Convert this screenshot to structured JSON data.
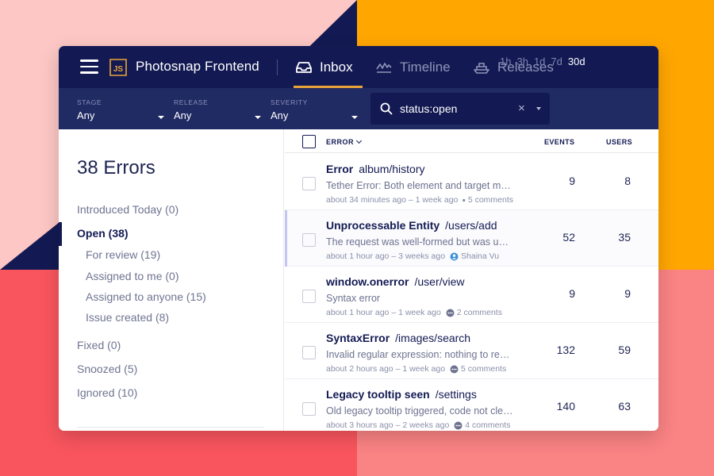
{
  "app": {
    "project_name": "Photosnap Frontend",
    "logo_text": "JS",
    "tabs": [
      {
        "label": "Inbox",
        "icon": "inbox-icon",
        "active": true
      },
      {
        "label": "Timeline",
        "icon": "timeline-icon",
        "active": false
      },
      {
        "label": "Releases",
        "icon": "ship-icon",
        "active": false
      }
    ]
  },
  "filters": [
    {
      "label": "STAGE",
      "value": "Any"
    },
    {
      "label": "RELEASE",
      "value": "Any"
    },
    {
      "label": "SEVERITY",
      "value": "Any"
    }
  ],
  "search": {
    "value": "status:open",
    "clear_icon": "×"
  },
  "time_ranges": [
    {
      "label": "1h",
      "active": false
    },
    {
      "label": "3h",
      "active": false
    },
    {
      "label": "1d",
      "active": false
    },
    {
      "label": "7d",
      "active": false
    },
    {
      "label": "30d",
      "active": true
    }
  ],
  "sidebar": {
    "error_count": "38 Errors",
    "items": [
      "Introduced Today (0)",
      "Open (38)",
      "For review (19)",
      "Assigned to me (0)",
      "Assigned to anyone (15)",
      "Issue created (8)",
      "Fixed (0)",
      "Snoozed (5)",
      "Ignored (10)"
    ]
  },
  "list": {
    "headers": {
      "error": "ERROR",
      "events": "EVENTS",
      "users": "USERS"
    },
    "rows": [
      {
        "type": "Error",
        "path": "album/history",
        "message": "Tether Error: Both element and target must be defined",
        "meta": "about 34 minutes ago – 1 week ago",
        "extra": "5 comments",
        "extra_icon": "comment-icon",
        "events": "9",
        "users": "8"
      },
      {
        "type": "Unprocessable Entity",
        "path": "/users/add",
        "message": "The request was well-formed but was unable to be followed",
        "meta": "about 1 hour ago – 3 weeks ago",
        "extra": "Shaina Vu",
        "extra_icon": "user-icon",
        "events": "52",
        "users": "35"
      },
      {
        "type": "window.onerror",
        "path": "/user/view",
        "message": "Syntax error",
        "meta": "about 1 hour ago – 1 week ago",
        "extra": "2 comments",
        "extra_icon": "comment-icon",
        "events": "9",
        "users": "9"
      },
      {
        "type": "SyntaxError",
        "path": "/images/search",
        "message": "Invalid regular expression: nothing to repeat",
        "meta": "about 2 hours ago – 1 week ago",
        "extra": "5 comments",
        "extra_icon": "comment-icon",
        "events": "132",
        "users": "59"
      },
      {
        "type": "Legacy tooltip seen",
        "path": "/settings",
        "message": "Old legacy tooltip triggered, code not cleaned up",
        "meta": "about 3 hours ago – 2 weeks ago",
        "extra": "4 comments",
        "extra_icon": "comment-icon",
        "events": "140",
        "users": "63"
      }
    ]
  },
  "colors": {
    "navy": "#131a53",
    "filterbar": "#202a63",
    "accent": "#e8a33a",
    "bg_orange": "#ffa600",
    "bg_red": "#f9555e"
  }
}
